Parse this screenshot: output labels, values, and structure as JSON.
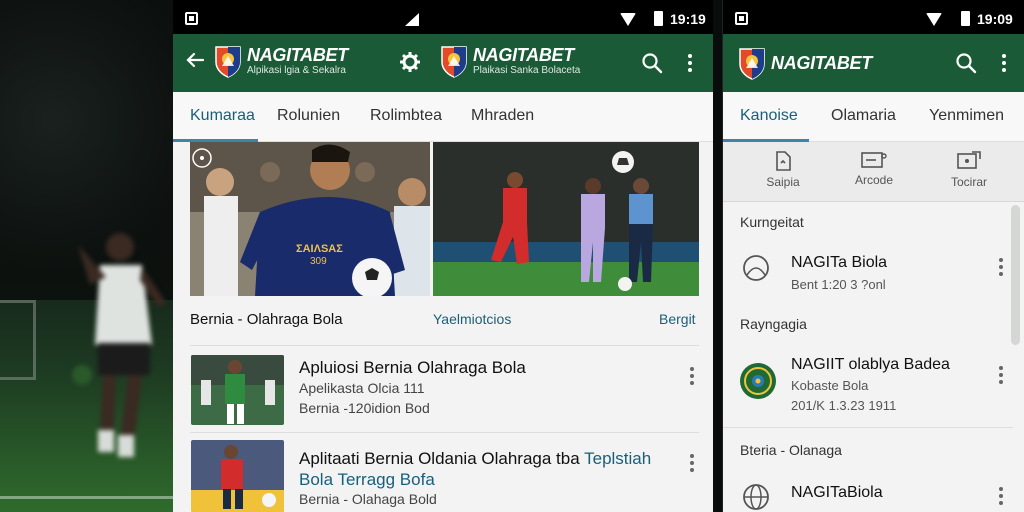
{
  "colors": {
    "appbar": "#1a5a36",
    "accent": "#1a5f7a",
    "status_bar": "#000000",
    "content_bg": "#f2f3f2"
  },
  "background": {
    "icon": "blurred-football-player-photo"
  },
  "phone_a": {
    "status": {
      "time": "19:19"
    },
    "appbar": {
      "back_icon": "arrow-left-icon",
      "brand_primary": {
        "name": "NAGITABET",
        "tagline": "Alpikasi lgia & Sekalra"
      },
      "settings_icon": "gear-icon",
      "brand_secondary": {
        "name": "NAGITABET",
        "tagline": "Plaikasi Sanka Bolaceta"
      },
      "search_icon": "search-icon",
      "menu_icon": "more-vert-icon"
    },
    "tabs": [
      {
        "label": "Kumaraa",
        "active": true
      },
      {
        "label": "Rolunien",
        "active": false
      },
      {
        "label": "Rolimbtea",
        "active": false
      },
      {
        "label": "Mhraden",
        "active": false
      }
    ],
    "hero": {
      "left_image": "football-player-dribbling-photo",
      "right_image": "football-match-players-photo",
      "caption": "Bernia - Olahraga Bola",
      "link_1": "Yaelmiotcios",
      "link_2": "Bergit"
    },
    "items": [
      {
        "title": "Apluiosi Bernia Olahraga Bola",
        "subtitle": "Apelikasta Olcia 111",
        "meta": "Bernia -120idion Bod"
      },
      {
        "title_plain": "Aplitaati Bernia Oldania Olahraga tba",
        "title_accent_1": "Teplstiah",
        "title_accent_2": "Bola Terragg Bofa",
        "meta": "Bernia - Olahaga Bold"
      }
    ]
  },
  "phone_b": {
    "status": {
      "time": "19:09"
    },
    "appbar": {
      "brand": "NAGITABET",
      "search_icon": "search-icon",
      "menu_icon": "more-vert-icon"
    },
    "tabs": [
      {
        "label": "Kanoise",
        "active": true
      },
      {
        "label": "Olamaria",
        "active": false
      },
      {
        "label": "Yenmimen",
        "active": false
      }
    ],
    "quick_actions": [
      {
        "label": "Saipia",
        "icon": "document-icon"
      },
      {
        "label": "Arcode",
        "icon": "ticket-icon"
      },
      {
        "label": "Tocirar",
        "icon": "screen-share-icon"
      }
    ],
    "sections": [
      {
        "header": "Kurngeitat",
        "rows": [
          {
            "title": "NAGITa Biola",
            "subtitle": "Bent 1:20 3 ?onl",
            "icon": "football-outline-icon"
          }
        ]
      },
      {
        "header": "Rayngagia",
        "rows": [
          {
            "title": "NAGIIT olablya Badea",
            "subtitle": "Kobaste Bola",
            "meta": "201/K 1.3.23 1911",
            "icon": "badge-logo-icon"
          }
        ]
      },
      {
        "header": "Bteria - Olanaga",
        "rows": [
          {
            "title": "NAGITaBiola",
            "icon": "globe-icon"
          }
        ]
      }
    ]
  }
}
